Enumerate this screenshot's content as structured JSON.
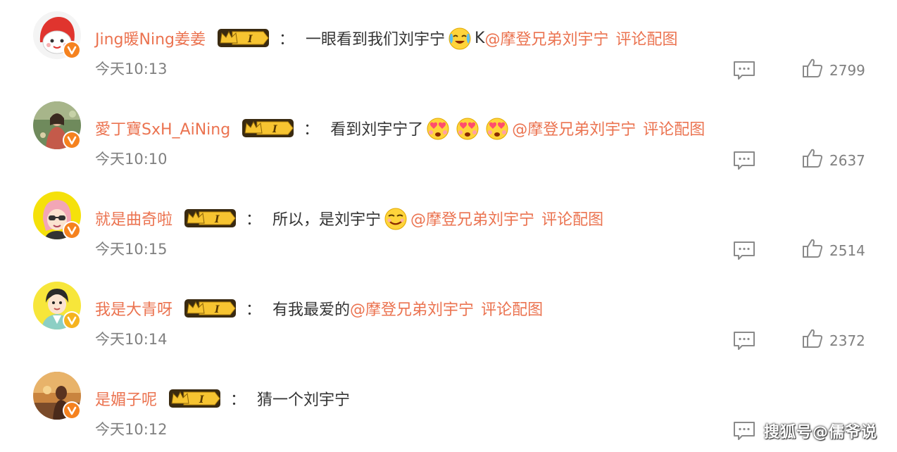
{
  "link_color": "#eb7350",
  "comments": [
    {
      "username": "Jing暖Ning姜姜",
      "separator": "：",
      "text_before": "一眼看到我们刘宇宁",
      "emojis": [
        "crying-laugh-emoji"
      ],
      "text_after": "K",
      "mention": "@摩登兄弟刘宇宁",
      "link": "评论配图",
      "time": "今天10:13",
      "likes": "2799",
      "avatar_icon": "red-hood-cartoon-avatar"
    },
    {
      "username": "愛丁寶SxH_AiNing",
      "separator": "：",
      "text_before": "看到刘宇宁了",
      "emojis": [
        "heart-eyes-emoji",
        "heart-eyes-emoji",
        "heart-eyes-emoji"
      ],
      "text_after": "",
      "mention": "@摩登兄弟刘宇宁",
      "link": "评论配图",
      "time": "今天10:10",
      "likes": "2637",
      "avatar_icon": "photo-avatar"
    },
    {
      "username": "就是曲奇啦",
      "separator": "：",
      "text_before": "所以，是刘宇宁",
      "emojis": [
        "smirk-emoji"
      ],
      "text_after": "",
      "mention": "@摩登兄弟刘宇宁",
      "link": "评论配图",
      "time": "今天10:15",
      "likes": "2514",
      "avatar_icon": "cartoon-girl-avatar"
    },
    {
      "username": "我是大青呀",
      "separator": "：",
      "text_before": "有我最爱的",
      "emojis": [],
      "text_after": "",
      "mention": "@摩登兄弟刘宇宁",
      "link": "评论配图",
      "time": "今天10:14",
      "likes": "2372",
      "avatar_icon": "cartoon-boy-avatar"
    },
    {
      "username": "是媚子呢",
      "separator": "：",
      "text_before": "猜一个刘宇宁",
      "emojis": [],
      "text_after": "",
      "mention": "",
      "link": "",
      "time": "今天10:12",
      "likes": "",
      "avatar_icon": "sunset-photo-avatar"
    }
  ],
  "watermark": "搜狐号@儒爷说"
}
